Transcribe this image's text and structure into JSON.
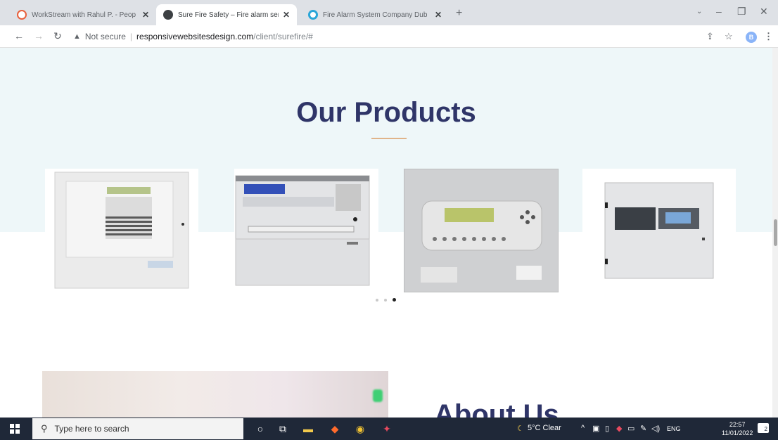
{
  "browser": {
    "tabs": [
      {
        "title": "WorkStream with Rahul P. - Peop",
        "close": "✕",
        "favicon_color": "#e8603c"
      },
      {
        "title": "Sure Fire Safety – Fire alarm serv",
        "close": "✕",
        "favicon_color": "#3c4043"
      },
      {
        "title": "Fire Alarm System Company Dub",
        "close": "✕",
        "favicon_color": "#2aa6d8"
      }
    ],
    "new_tab": "+",
    "security_label": "Not secure",
    "url_host": "responsivewebsitesdesign.com",
    "url_path": "/client/surefire/#",
    "profile_initial": "B"
  },
  "page": {
    "heading": "Our Products",
    "carousel": {
      "slides": 3,
      "active_index": 2
    },
    "about_heading": "About Us"
  },
  "taskbar": {
    "search_placeholder": "Type here to search",
    "weather": "5°C  Clear",
    "language": "ENG",
    "time": "22:57",
    "date": "11/01/2022",
    "notification_count": "2"
  }
}
